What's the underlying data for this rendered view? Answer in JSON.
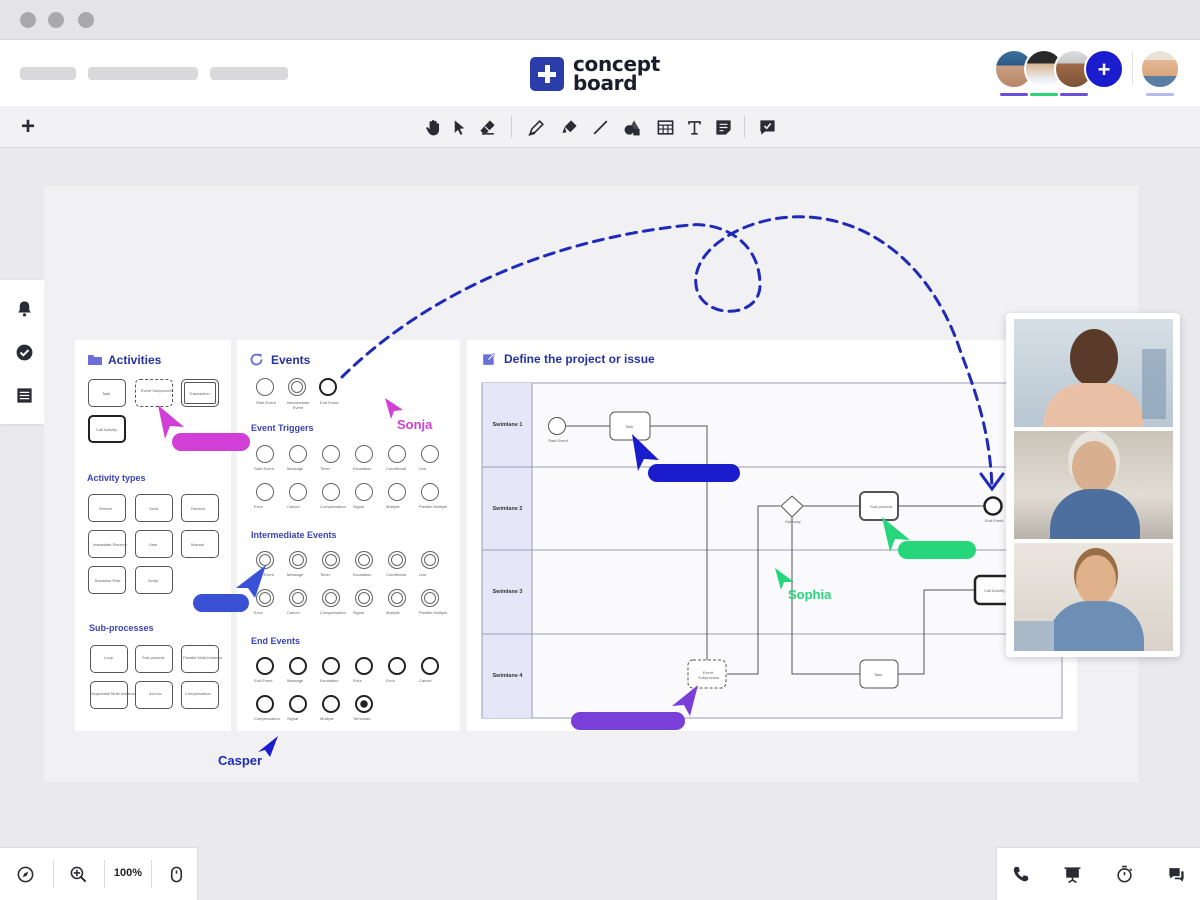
{
  "app": {
    "logo_line1": "concept",
    "logo_line2": "board"
  },
  "header": {
    "collaborators": [
      {
        "name": "collaborator-1",
        "underline": "#6b4fd8"
      },
      {
        "name": "collaborator-2",
        "underline": "#2ed47a"
      },
      {
        "name": "collaborator-3",
        "underline": "#6b4fd8"
      }
    ],
    "invite_label": "+",
    "self_underline": "#b9b9f0"
  },
  "toolbar": {
    "add_label": "+",
    "tools": [
      "hand-icon",
      "pointer-icon",
      "eraser-icon",
      "pen-icon",
      "highlighter-icon",
      "line-icon",
      "shapes-icon",
      "table-icon",
      "text-icon",
      "sticky-note-icon",
      "comment-icon"
    ]
  },
  "sidebar": {
    "items": [
      "bell-icon",
      "check-icon",
      "list-icon"
    ]
  },
  "board": {
    "activities": {
      "title": "Activities",
      "shapes": [
        "Task",
        "Event Subprocess",
        "Transaction",
        "Call Activity"
      ],
      "types_title": "Activity types",
      "types": [
        "Service",
        "Send",
        "Receive",
        "Instantiate Receive",
        "User",
        "Manual",
        "Business Rule",
        "Script"
      ],
      "subprocesses_title": "Sub-processes",
      "subprocesses": [
        "Loop",
        "Sub-process",
        "Parallel Multi-Instance",
        "Sequential Multi-Instance",
        "Ad-hoc",
        "Compensation"
      ]
    },
    "events": {
      "title": "Events",
      "top": [
        "Start Event",
        "Intermediate Event",
        "End Event"
      ],
      "triggers_title": "Event Triggers",
      "triggers": [
        "Start Event",
        "Message",
        "Timer",
        "Escalation",
        "Conditional",
        "Link",
        "Error",
        "Cancel",
        "Compensation",
        "Signal",
        "Multiple",
        "Parallel Multiple"
      ],
      "intermediate_title": "Intermediate Events",
      "intermediate": [
        "Start Event",
        "Message",
        "Timer",
        "Escalation",
        "Conditional",
        "Link",
        "Error",
        "Cancel",
        "Compensation",
        "Signal",
        "Multiple",
        "Parallel Multiple"
      ],
      "end_title": "End Events",
      "end": [
        "End Event",
        "Message",
        "Escalation",
        "Error",
        "Error",
        "Cancel",
        "Compensation",
        "Signal",
        "Multiple",
        "Terminate"
      ]
    },
    "diagram": {
      "title": "Define the project or issue",
      "lanes": [
        "Swimlane 1",
        "Swimlane 2",
        "Swimlane 3",
        "Swimlane 4"
      ],
      "nodes": {
        "start": "Start Event",
        "task1": "Task",
        "gateway": "Gateway",
        "subprocess": "Sub-process",
        "end": "End Event",
        "call": "Call Activity",
        "task2": "Task",
        "event_sub": "Event Subprocess"
      }
    }
  },
  "cursors": [
    {
      "name": "Sonja",
      "color": "#d13fd6"
    },
    {
      "name": "Sophia",
      "color": "#26d67a"
    },
    {
      "name": "Casper",
      "color": "#1f2bb8"
    }
  ],
  "video_call": {
    "participants": [
      "participant-1",
      "participant-2",
      "participant-3"
    ]
  },
  "bottom": {
    "zoom": "100%"
  },
  "colors": {
    "accent": "#1a1ccd",
    "brand": "#2a3da8",
    "purple": "#6b3fd8"
  }
}
